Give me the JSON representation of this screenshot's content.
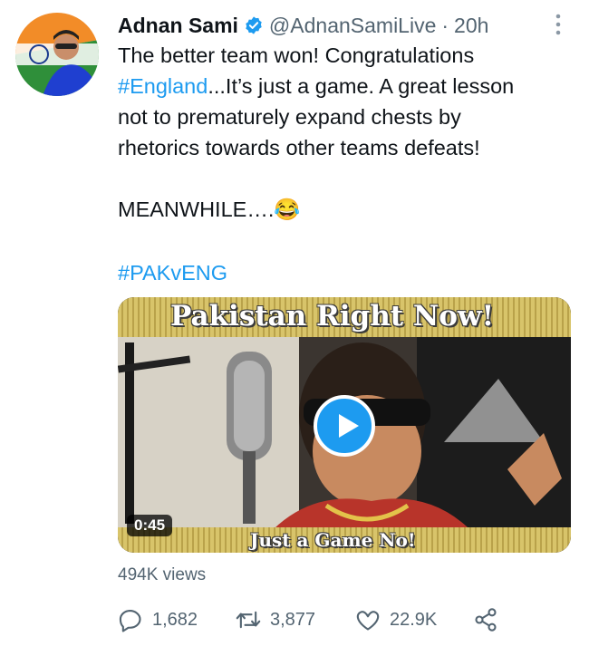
{
  "tweet": {
    "author_name": "Adnan Sami",
    "handle": "@AdnanSamiLive",
    "separator": "·",
    "time": "20h",
    "lines": [
      {
        "plain": "The better team won! Congratulations"
      },
      {
        "tag": "#England",
        "plain": "...It’s just a game. A great lesson"
      },
      {
        "plain": "not to prematurely expand  chests by"
      },
      {
        "plain": "rhetorics towards other teams defeats!"
      }
    ],
    "meanwhile": "MEANWHILE….",
    "emoji": "😂",
    "hashtag": "#PAKvENG",
    "icons": {
      "verified": "verified-badge-icon",
      "more": "more-options-icon",
      "reply": "reply-icon",
      "retweet": "retweet-icon",
      "like": "like-icon",
      "share": "share-icon",
      "play": "play-icon"
    }
  },
  "media": {
    "top_caption": "Pakistan Right Now!",
    "bottom_caption": "Just a Game No!",
    "duration": "0:45"
  },
  "stats": {
    "views": "494K views",
    "replies": "1,682",
    "retweets": "3,877",
    "likes": "22.9K"
  },
  "colors": {
    "accent": "#1d9bf0",
    "secondary_text": "#536471",
    "primary_text": "#0f1419"
  }
}
